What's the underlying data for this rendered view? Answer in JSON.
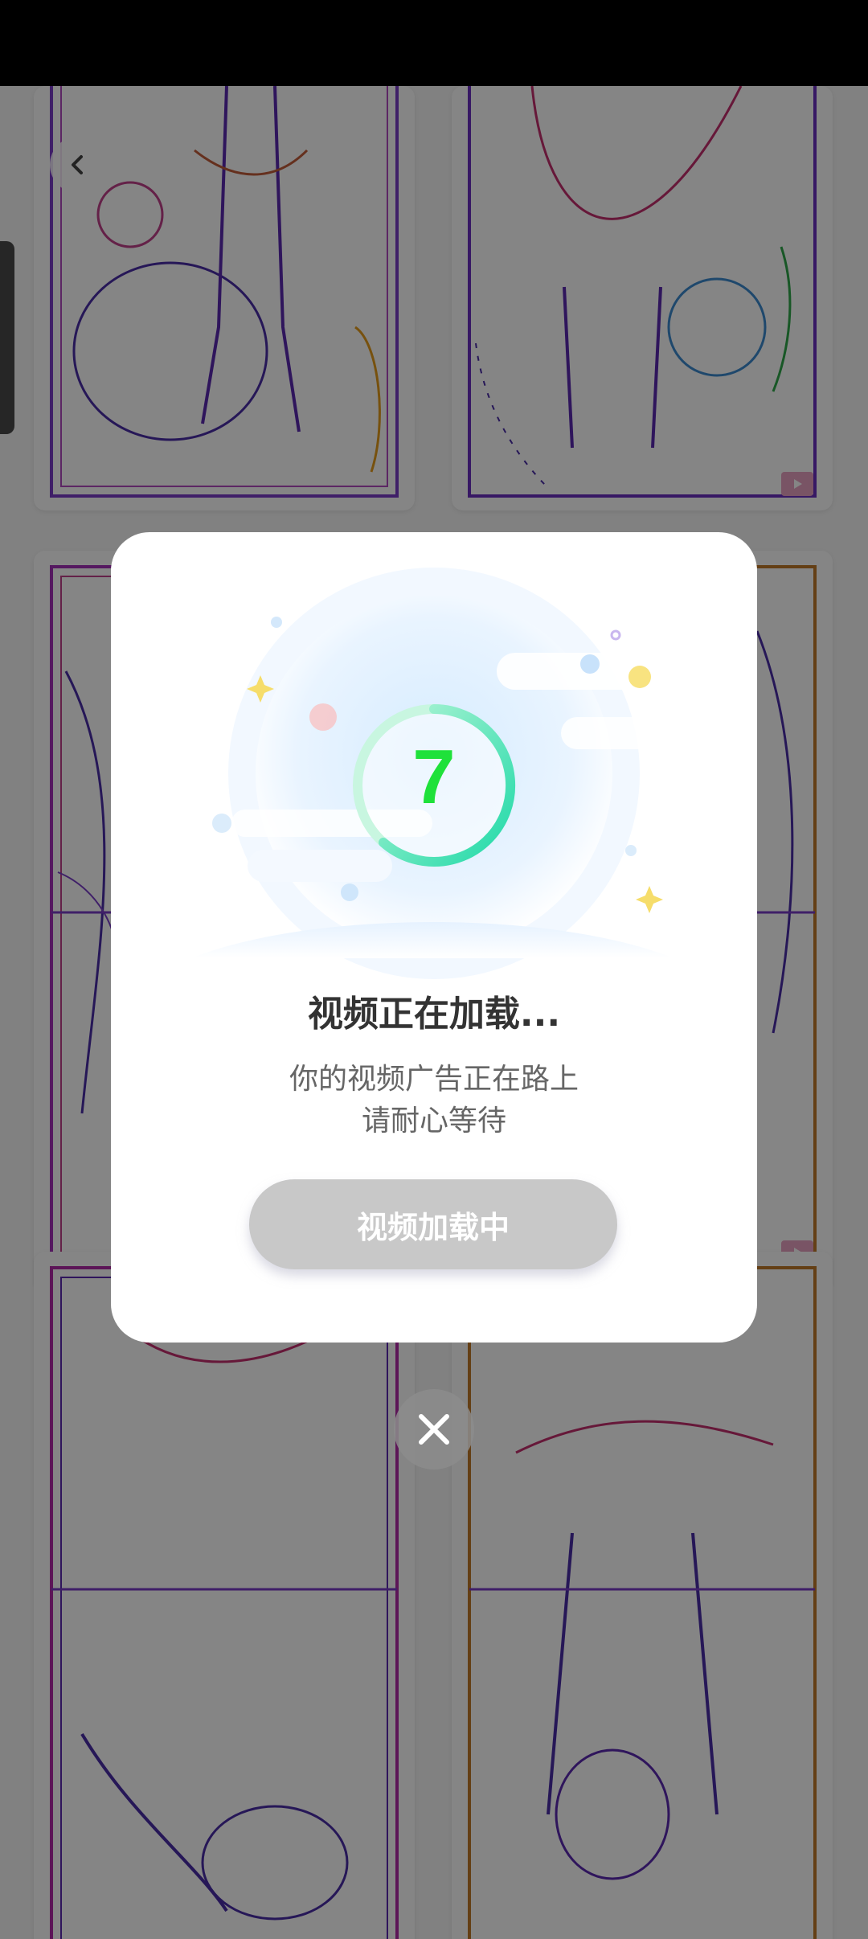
{
  "dialog": {
    "countdown": "7",
    "title": "视频正在加载...",
    "message_line1": "你的视频广告正在路上",
    "message_line2": "请耐心等待",
    "button_label": "视频加载中"
  },
  "colors": {
    "countdown_green": "#1fe13a",
    "ring_start": "#b5f5d6",
    "ring_end": "#1fd9a8",
    "button_gray": "#c8c8c8"
  },
  "icons": {
    "back": "chevron-left-icon",
    "close": "close-icon",
    "video_badge": "video-play-icon"
  }
}
